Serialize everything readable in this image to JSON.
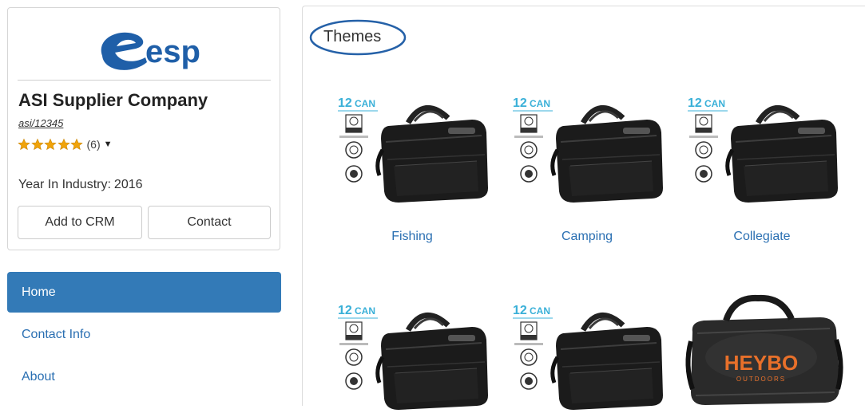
{
  "logo": {
    "text": "esp",
    "color": "#1f5fa8"
  },
  "supplier": {
    "name": "ASI Supplier Company",
    "asi_number": "asi/12345",
    "rating_stars": 5,
    "review_count": "(6)",
    "year_label": "Year In Industry:",
    "year_value": "2016"
  },
  "actions": {
    "add_to_crm": "Add to CRM",
    "contact": "Contact"
  },
  "nav": {
    "items": [
      {
        "label": "Home",
        "active": true
      },
      {
        "label": "Contact Info",
        "active": false
      },
      {
        "label": "About",
        "active": false
      }
    ]
  },
  "main": {
    "title": "Themes",
    "themes": [
      {
        "label": "Fishing",
        "image": "12can-cooler-bag"
      },
      {
        "label": "Camping",
        "image": "12can-cooler-bag"
      },
      {
        "label": "Collegiate",
        "image": "12can-cooler-bag"
      },
      {
        "label": "",
        "image": "12can-cooler-bag"
      },
      {
        "label": "",
        "image": "12can-cooler-bag"
      },
      {
        "label": "",
        "image": "heybo-duffel-bag"
      }
    ],
    "image_texts": {
      "can": "12CAN",
      "brand": "HEYBO",
      "brand_sub": "OUTDOORS"
    }
  },
  "colors": {
    "accent": "#337ab7",
    "link": "#2a6fb2",
    "star": "#f0a30a",
    "can_text": "#3ab0d8",
    "heybo_orange": "#e8702a"
  }
}
